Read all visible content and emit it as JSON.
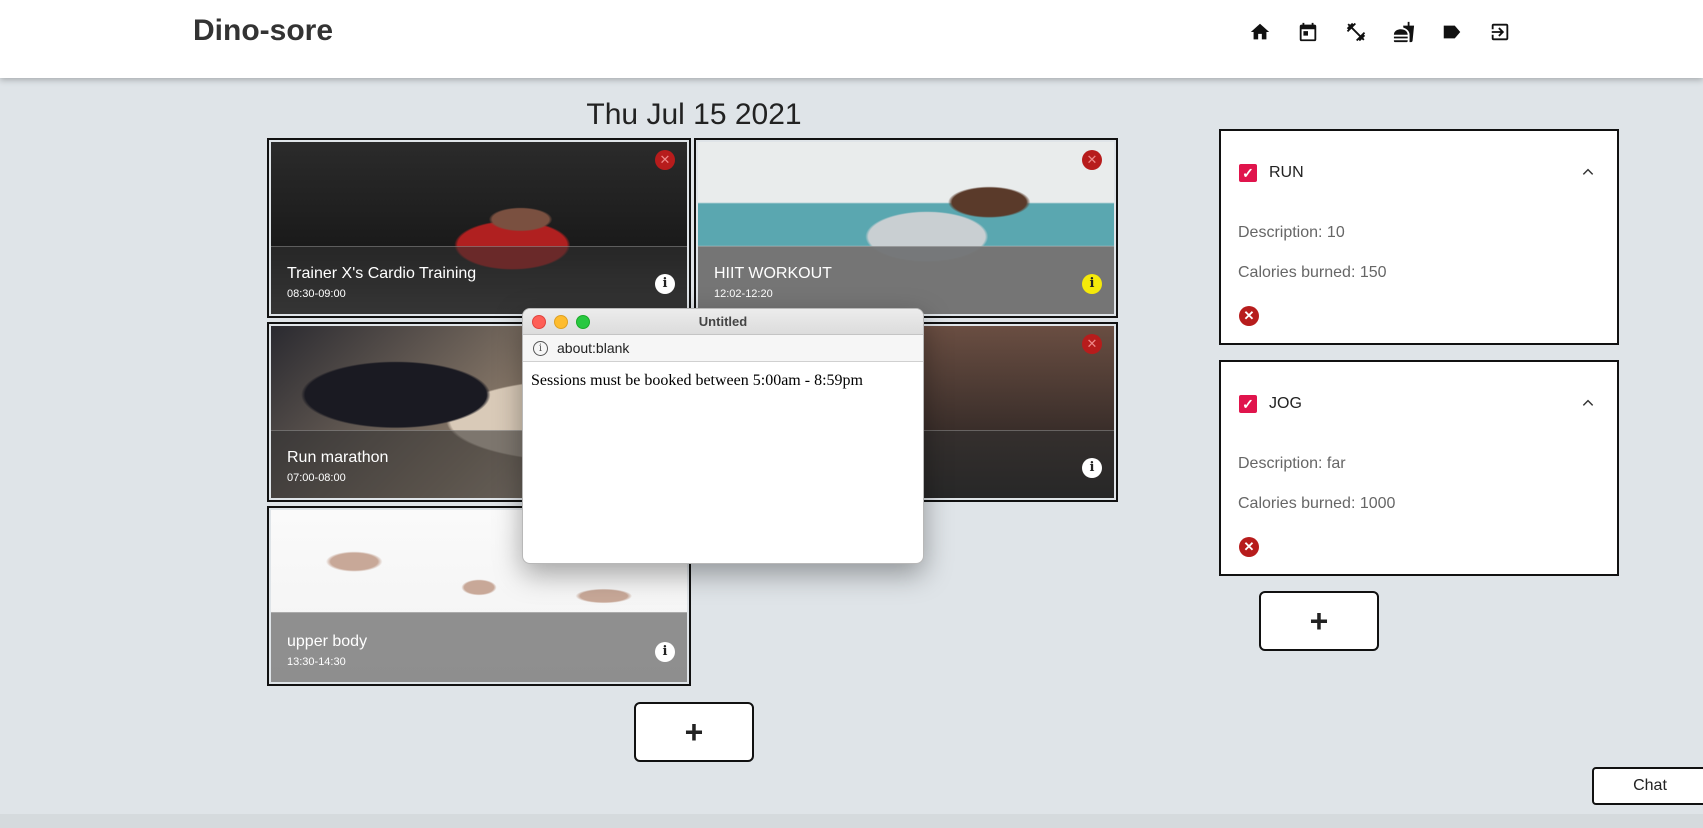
{
  "app": {
    "brand": "Dino-sore"
  },
  "nav": [
    {
      "icon": "home-icon"
    },
    {
      "icon": "calendar-icon"
    },
    {
      "icon": "fitness-icon"
    },
    {
      "icon": "food-icon"
    },
    {
      "icon": "label-icon"
    },
    {
      "icon": "logout-icon"
    }
  ],
  "date_title": "Thu Jul 15 2021",
  "sessions": [
    {
      "title": "Trainer X's Cardio Training",
      "time": "08:30-09:00",
      "info_color": "#ffffff"
    },
    {
      "title": "HIIT WORKOUT",
      "time": "12:02-12:20",
      "info_color": "#f5e90a"
    },
    {
      "title": "Run marathon",
      "time": "07:00-08:00",
      "info_color": "#ffffff"
    },
    {
      "title": "",
      "time": "",
      "info_color": "#ffffff"
    },
    {
      "title": "upper body",
      "time": "13:30-14:30",
      "info_color": "#ffffff"
    }
  ],
  "popup": {
    "window_title": "Untitled",
    "url": "about:blank",
    "message": "Sessions must be booked between 5:00am - 8:59pm"
  },
  "activities": [
    {
      "name": "RUN",
      "description": "Description: 10",
      "calories": "Calories burned: 150"
    },
    {
      "name": "JOG",
      "description": "Description: far",
      "calories": "Calories burned: 1000"
    }
  ],
  "buttons": {
    "add_session": "+",
    "add_activity": "+",
    "chat": "Chat"
  },
  "colors": {
    "accent": "#e0144c",
    "delete": "#b71c1c",
    "info_highlight": "#f5e90a"
  }
}
